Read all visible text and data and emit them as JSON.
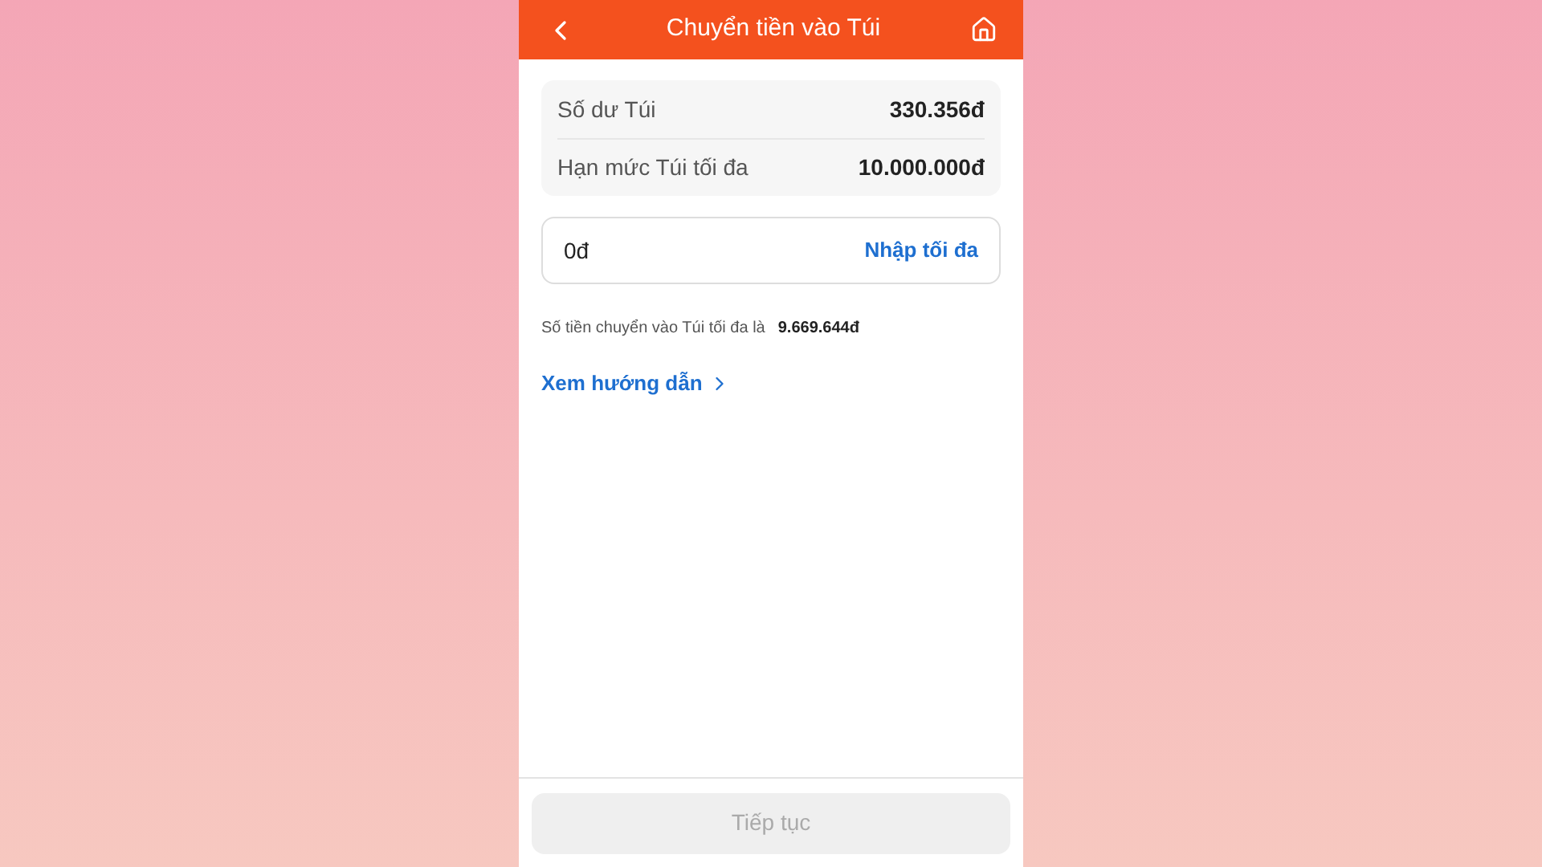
{
  "header": {
    "title": "Chuyển tiền vào Túi"
  },
  "summary": [
    {
      "label": "Số dư Túi",
      "value": "330.356đ"
    },
    {
      "label": "Hạn mức Túi tối đa",
      "value": "10.000.000đ"
    }
  ],
  "amount_field": {
    "value": "0đ",
    "action": "Nhập tối đa"
  },
  "note": {
    "text": "Số tiền chuyển vào Túi tối đa là",
    "amount": "9.669.644đ"
  },
  "guide_link": {
    "label": "Xem hướng dẫn"
  },
  "continue_button": {
    "label": "Tiếp tục",
    "disabled": true
  }
}
